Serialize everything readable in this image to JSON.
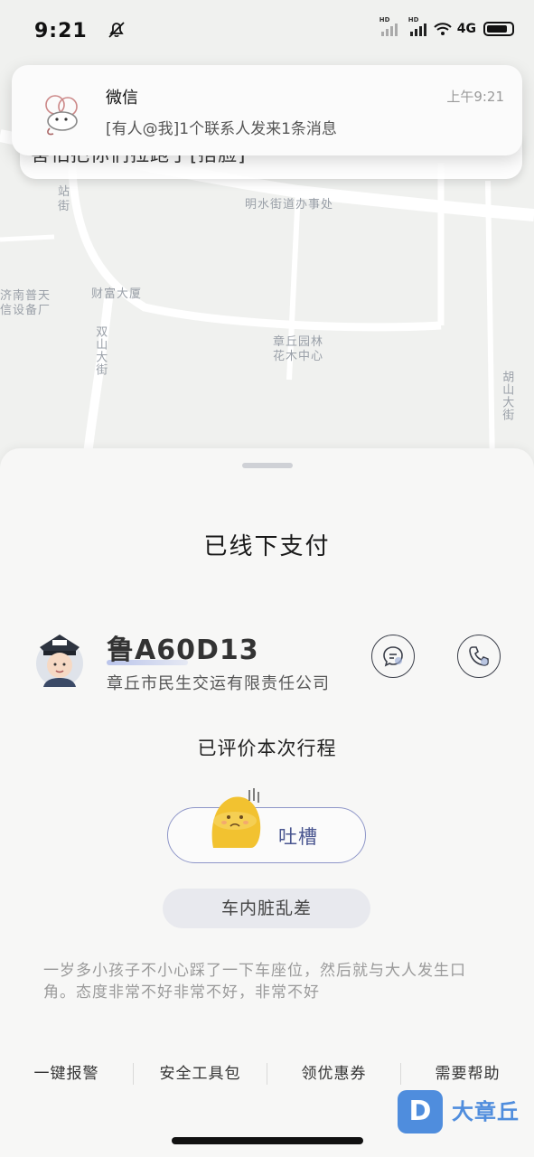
{
  "status_bar": {
    "time": "9:21",
    "network": "4G",
    "hd": "HD"
  },
  "notification": {
    "app": "微信",
    "time": "上午9:21",
    "message": "[有人@我]1个联系人发来1条消息",
    "app_icon": "wechat-sticker-icon"
  },
  "behind_notification_text": "害怕把你们拉跑了[捂脸]",
  "map": {
    "labels": {
      "office": "明水街道办事处",
      "building": "财富大厦",
      "company_left": "济南普天\n信设备厂",
      "nursery": "章丘园林\n花木中心",
      "station_st": "站\n街",
      "shuangshan": "双山大街",
      "hushan": "胡山大街"
    }
  },
  "sheet": {
    "title": "已线下支付",
    "driver": {
      "plate": "鲁A60D13",
      "company": "章丘市民生交运有限责任公司",
      "avatar_icon": "taxi-driver-avatar-icon"
    },
    "rated_label": "已评价本次行程",
    "complain_label": "吐槽",
    "tag": "车内脏乱差",
    "comment": "一岁多小孩子不小心踩了一下车座位，然后就与大人发生口角。态度非常不好非常不好，非常不好",
    "actions": [
      "一键报警",
      "安全工具包",
      "领优惠券",
      "需要帮助"
    ]
  },
  "watermark": {
    "badge": "D",
    "text": "大章丘"
  },
  "colors": {
    "accent": "#4a5690",
    "watermark": "#4f8ddd"
  }
}
